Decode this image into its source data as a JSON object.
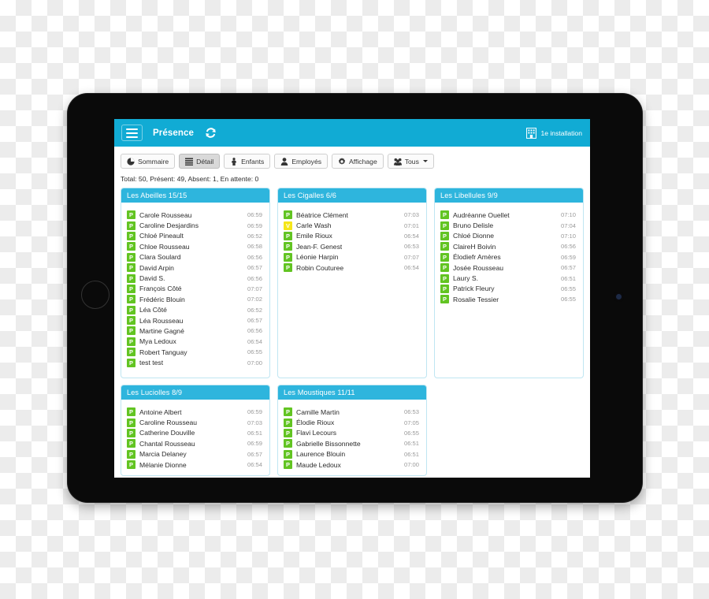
{
  "navbar": {
    "menu_icon": "hamburger-icon",
    "title": "Présence",
    "refresh_icon": "refresh-icon",
    "installation_icon": "building-icon",
    "installation_label": "1e installation",
    "background_color": "#11abd4"
  },
  "toolbar": {
    "buttons": [
      {
        "label": "Sommaire",
        "icon": "pie-chart-icon",
        "active": false,
        "caret": false
      },
      {
        "label": "Détail",
        "icon": "list-icon",
        "active": true,
        "caret": false
      },
      {
        "label": "Enfants",
        "icon": "child-icon",
        "active": false,
        "caret": false
      },
      {
        "label": "Employés",
        "icon": "user-icon",
        "active": false,
        "caret": false
      },
      {
        "label": "Affichage",
        "icon": "gear-icon",
        "active": false,
        "caret": false
      },
      {
        "label": "Tous",
        "icon": "group-icon",
        "active": false,
        "caret": true
      }
    ]
  },
  "summary": {
    "text": "Total: 50, Présent: 49, Absent: 1, En attente: 0"
  },
  "legend": {
    "present_badge": "P",
    "vacation_badge": "V",
    "present_color": "#62c422",
    "vacation_color": "#f5e619",
    "panel_header_color": "#2eb5dd"
  },
  "groups": [
    {
      "title": "Les Abeilles 15/15",
      "size": "tall",
      "members": [
        {
          "status": "P",
          "name": "Carole Rousseau",
          "time": "06:59"
        },
        {
          "status": "P",
          "name": "Caroline Desjardins",
          "time": "06:59"
        },
        {
          "status": "P",
          "name": "Chloé Pineault",
          "time": "06:52"
        },
        {
          "status": "P",
          "name": "Chloe Rousseau",
          "time": "06:58"
        },
        {
          "status": "P",
          "name": "Clara Soulard",
          "time": "06:56"
        },
        {
          "status": "P",
          "name": "David Arpin",
          "time": "06:57"
        },
        {
          "status": "P",
          "name": "David S.",
          "time": "06:56"
        },
        {
          "status": "P",
          "name": "François Côté",
          "time": "07:07"
        },
        {
          "status": "P",
          "name": "Frédéric Blouin",
          "time": "07:02"
        },
        {
          "status": "P",
          "name": "Léa Côté",
          "time": "06:52"
        },
        {
          "status": "P",
          "name": "Léa Rousseau",
          "time": "06:57"
        },
        {
          "status": "P",
          "name": "Martine Gagné",
          "time": "06:56"
        },
        {
          "status": "P",
          "name": "Mya Ledoux",
          "time": "06:54"
        },
        {
          "status": "P",
          "name": "Robert Tanguay",
          "time": "06:55"
        },
        {
          "status": "P",
          "name": "test test",
          "time": "07:00"
        }
      ]
    },
    {
      "title": "Les Cigalles 6/6",
      "size": "tall",
      "members": [
        {
          "status": "P",
          "name": "Béatrice Clément",
          "time": "07:03"
        },
        {
          "status": "V",
          "name": "Carle Wash",
          "time": "07:01"
        },
        {
          "status": "P",
          "name": "Emile Rioux",
          "time": "06:54"
        },
        {
          "status": "P",
          "name": "Jean-F. Genest",
          "time": "06:53"
        },
        {
          "status": "P",
          "name": "Léonie Harpin",
          "time": "07:07"
        },
        {
          "status": "P",
          "name": "Robin Couturee",
          "time": "06:54"
        }
      ]
    },
    {
      "title": "Les Libellules 9/9",
      "size": "tall",
      "members": [
        {
          "status": "P",
          "name": "Audréanne Ouellet",
          "time": "07:10"
        },
        {
          "status": "P",
          "name": "Bruno Delisle",
          "time": "07:04"
        },
        {
          "status": "P",
          "name": "Chloé Dionne",
          "time": "07:10"
        },
        {
          "status": "P",
          "name": "ClaireH Boivin",
          "time": "06:56"
        },
        {
          "status": "P",
          "name": "Élodiefr Amères",
          "time": "06:59"
        },
        {
          "status": "P",
          "name": "Josée Rousseau",
          "time": "06:57"
        },
        {
          "status": "P",
          "name": "Laury S.",
          "time": "06:51"
        },
        {
          "status": "P",
          "name": "Patrick Fleury",
          "time": "06:55"
        },
        {
          "status": "P",
          "name": "Rosalie Tessier",
          "time": "06:55"
        }
      ]
    },
    {
      "title": "Les Luciolles 8/9",
      "size": "short",
      "members": [
        {
          "status": "P",
          "name": "Antoine Albert",
          "time": "06:59"
        },
        {
          "status": "P",
          "name": "Caroline Rousseau",
          "time": "07:03"
        },
        {
          "status": "P",
          "name": "Catherine Douville",
          "time": "06:51"
        },
        {
          "status": "P",
          "name": "Chantal Rousseau",
          "time": "06:59"
        },
        {
          "status": "P",
          "name": "Marcia Delaney",
          "time": "06:57"
        },
        {
          "status": "P",
          "name": "Mélanie Dionne",
          "time": "06:54"
        }
      ]
    },
    {
      "title": "Les Moustiques 11/11",
      "size": "short",
      "members": [
        {
          "status": "P",
          "name": "Camille Martin",
          "time": "06:53"
        },
        {
          "status": "P",
          "name": "Élodie Rioux",
          "time": "07:05"
        },
        {
          "status": "P",
          "name": "Flavi Lecours",
          "time": "06:55"
        },
        {
          "status": "P",
          "name": "Gabrielle Bissonnette",
          "time": "06:51"
        },
        {
          "status": "P",
          "name": "Laurence Blouin",
          "time": "06:51"
        },
        {
          "status": "P",
          "name": "Maude Ledoux",
          "time": "07:00"
        }
      ]
    }
  ]
}
